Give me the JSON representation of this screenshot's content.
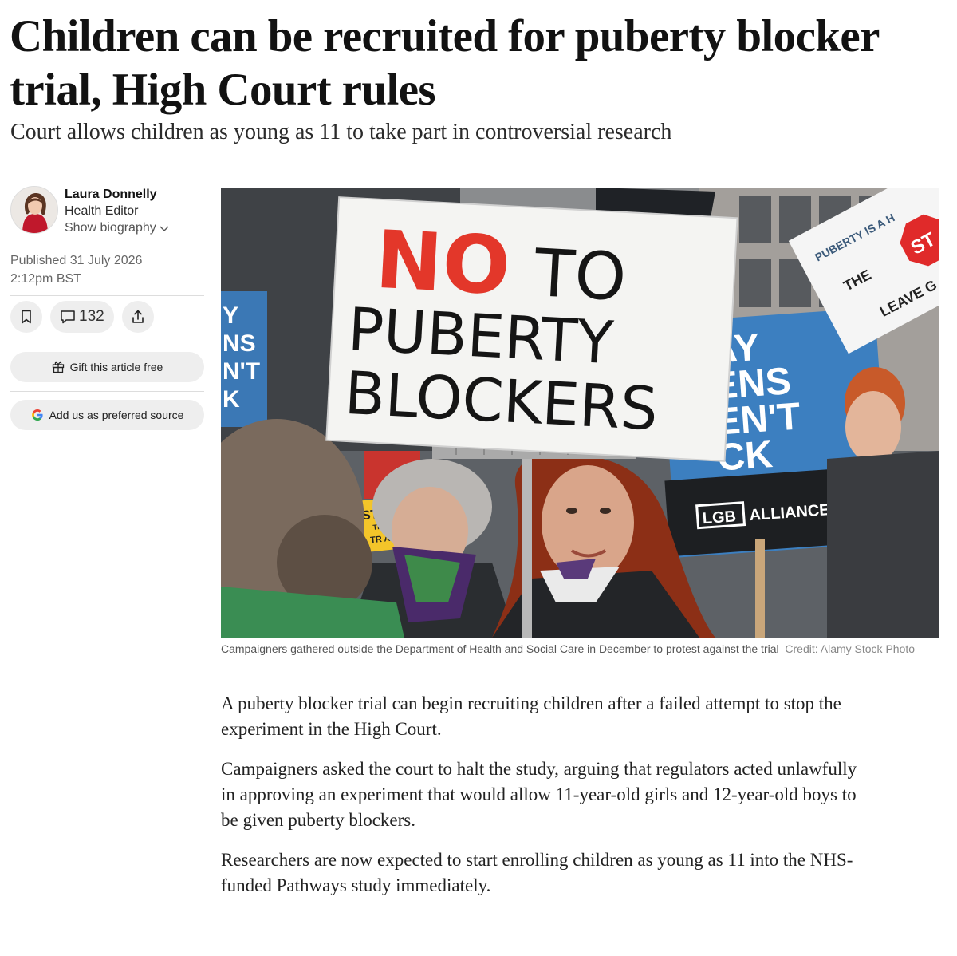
{
  "article": {
    "headline": "Children can be recruited for puberty blocker trial, High Court rules",
    "standfirst": "Court allows children as young as 11 to take part in controversial research",
    "author": {
      "name": "Laura Donnelly",
      "role": "Health Editor",
      "bio_toggle": "Show biography"
    },
    "published": {
      "line1": "Published 31 July 2026",
      "line2": "2:12pm BST"
    },
    "actions": {
      "comment_count": "132",
      "gift_label": "Gift this article free",
      "preferred_label": "Add us as preferred source"
    },
    "image": {
      "caption": "Campaigners gathered outside the Department of Health and Social Care in December to protest against the trial",
      "credit": "Credit: Alamy Stock Photo",
      "sign_no": "NO",
      "sign_to": "TO",
      "sign_line2": "PUBERTY",
      "sign_line3": "BLOCKERS",
      "lgb_box": "LGB",
      "lgb_alliance": "ALLIANCE",
      "blue_sign_lines": [
        "AY",
        "ENS",
        "EN'T",
        "CK"
      ],
      "left_sign_lines": [
        "Y",
        "NS",
        "N'T",
        "K"
      ],
      "right_sign_arc": "PUBERTY IS A H",
      "right_sign_the": "THE",
      "right_sign_leave": "LEAVE G",
      "stop_sign": "ST",
      "small_stop": "STOP",
      "small_the": "THE",
      "small_trial": "TR AL"
    },
    "paragraphs": [
      "A puberty blocker trial can begin recruiting children after a failed attempt to stop the experiment in the High Court.",
      "Campaigners asked the court to halt the study, arguing that regulators acted unlawfully in approving an experiment that would allow 11-year-old girls and 12-year-old boys to be given puberty blockers.",
      "Researchers are now expected to start enrolling children as young as 11 into the NHS-funded Pathways study immediately."
    ]
  }
}
